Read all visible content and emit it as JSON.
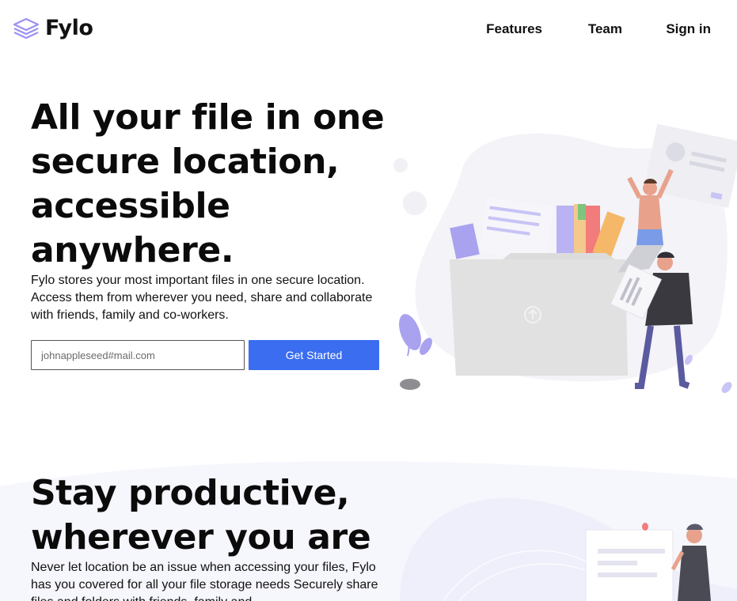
{
  "brand": {
    "name": "Fylo",
    "logo_icon": "layers-icon",
    "accent_color": "#9a91f5"
  },
  "nav": {
    "features": "Features",
    "team": "Team",
    "sign_in": "Sign in"
  },
  "hero": {
    "title_lines": [
      "All your file in one",
      "secure location,",
      "accessible",
      "anywhere."
    ],
    "description": "Fylo stores your most important files in one secure location. Access them from wherever you need, share and collaborate with friends, family and co-workers.",
    "email_placeholder": "johnappleseed#mail.com",
    "cta_label": "Get Started",
    "cta_color": "#3a6df0"
  },
  "section2": {
    "title_lines": [
      "Stay productive,",
      "wherever you are"
    ],
    "description": "Never let location be an issue when accessing your files, Fylo has you covered for all your file storage needs Securely share files and folders with friends, family and"
  }
}
